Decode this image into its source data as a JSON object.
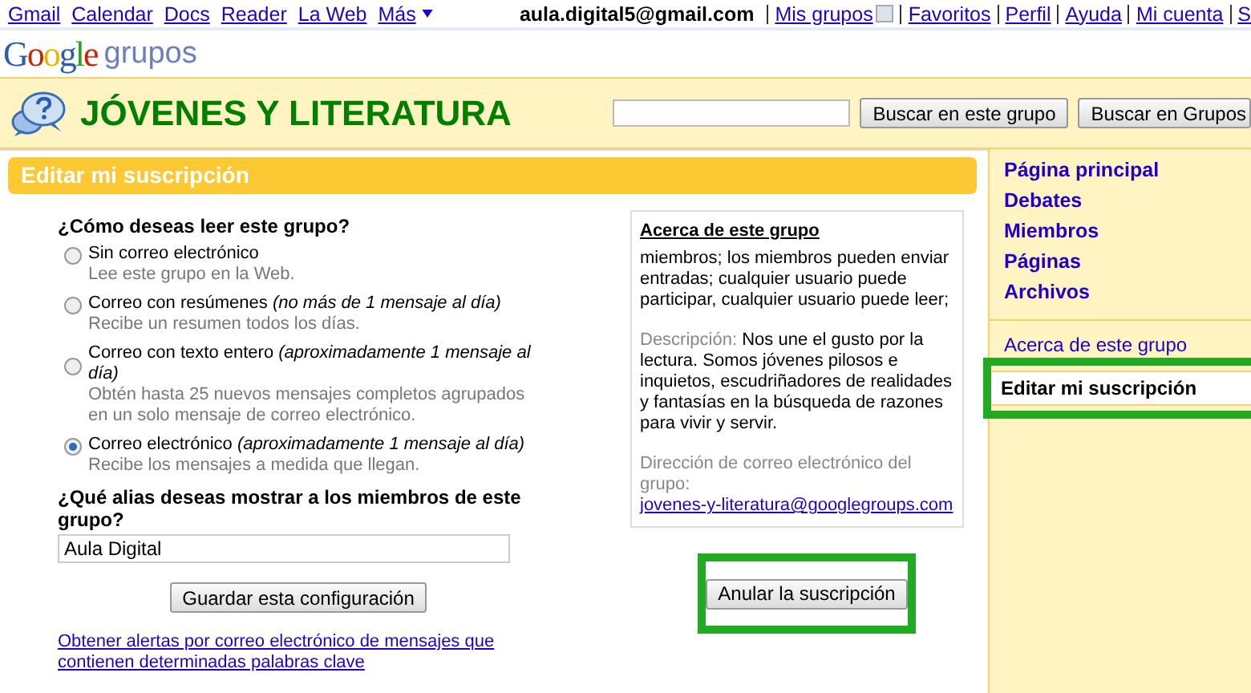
{
  "top_bar": {
    "links": [
      {
        "label": "Gmail",
        "kind": "link"
      },
      {
        "label": "Calendar",
        "kind": "link"
      },
      {
        "label": "Docs",
        "kind": "link"
      },
      {
        "label": "Reader",
        "kind": "link"
      },
      {
        "label": "La Web",
        "kind": "link"
      },
      {
        "label": "Más",
        "kind": "menu"
      }
    ],
    "account": "aula.digital5@gmail.com",
    "account_links": [
      {
        "label": "Mis grupos",
        "kind": "menu"
      },
      {
        "label": "Favoritos",
        "kind": "link"
      },
      {
        "label": "Perfil",
        "kind": "link"
      },
      {
        "label": "Ayuda",
        "kind": "link"
      },
      {
        "label": "Mi cuenta",
        "kind": "link"
      },
      {
        "label": "S",
        "kind": "link"
      }
    ]
  },
  "logo": {
    "brand": "Google",
    "product": "grupos"
  },
  "group": {
    "title": "JÓVENES Y LITERATURA",
    "search_buttons": [
      "Buscar en este grupo",
      "Buscar en Grupos"
    ]
  },
  "panel_title": "Editar mi suscripción",
  "form": {
    "question": "¿Cómo deseas leer este grupo?",
    "options": [
      {
        "label": "Sin correo electrónico",
        "hint": "Lee este grupo en la Web.",
        "selected": false
      },
      {
        "label": "Correo con resúmenes *(no más de 1 mensaje al día)*",
        "hint": "Recibe un resumen todos los días.",
        "selected": false
      },
      {
        "label": "Correo con texto entero *(aproximadamente 1 mensaje al día)*",
        "hint": "Obtén hasta 25 nuevos mensajes completos agrupados en un solo mensaje de correo electrónico.",
        "selected": false
      },
      {
        "label": "Correo electrónico *(aproximadamente 1 mensaje al día)*",
        "hint": "Recibe los mensajes a medida que llegan.",
        "selected": true
      }
    ],
    "alias_question": "¿Qué alias deseas mostrar a los miembros de este grupo?",
    "alias_value": "Aula Digital",
    "save_button": "Guardar esta configuración",
    "alerts_link": "Obtener alertas por correo electrónico de mensajes que contienen determinadas palabras clave"
  },
  "about": {
    "title": "Acerca de este grupo",
    "permissions": "miembros; los miembros pueden enviar entradas; cualquier usuario puede participar, cualquier usuario puede leer;",
    "description_label": "Descripción:",
    "description": "Nos une el gusto por la lectura. Somos jóvenes pilosos e inquietos, escudriñadores de realidades y fantasías en la búsqueda de razones para vivir y servir.",
    "email_label": "Dirección de correo electrónico del grupo:",
    "email": "jovenes-y-literatura@googlegroups.com"
  },
  "unsubscribe": {
    "label": "Anular la suscripción",
    "highlighted": true
  },
  "sidebar": {
    "nav": [
      "Página principal",
      "Debates",
      "Miembros",
      "Páginas",
      "Archivos"
    ],
    "items": [
      {
        "label": "Acerca de este grupo",
        "selected": false,
        "highlighted": false
      },
      {
        "label": "Editar mi suscripción",
        "selected": true,
        "highlighted": true
      }
    ]
  }
}
